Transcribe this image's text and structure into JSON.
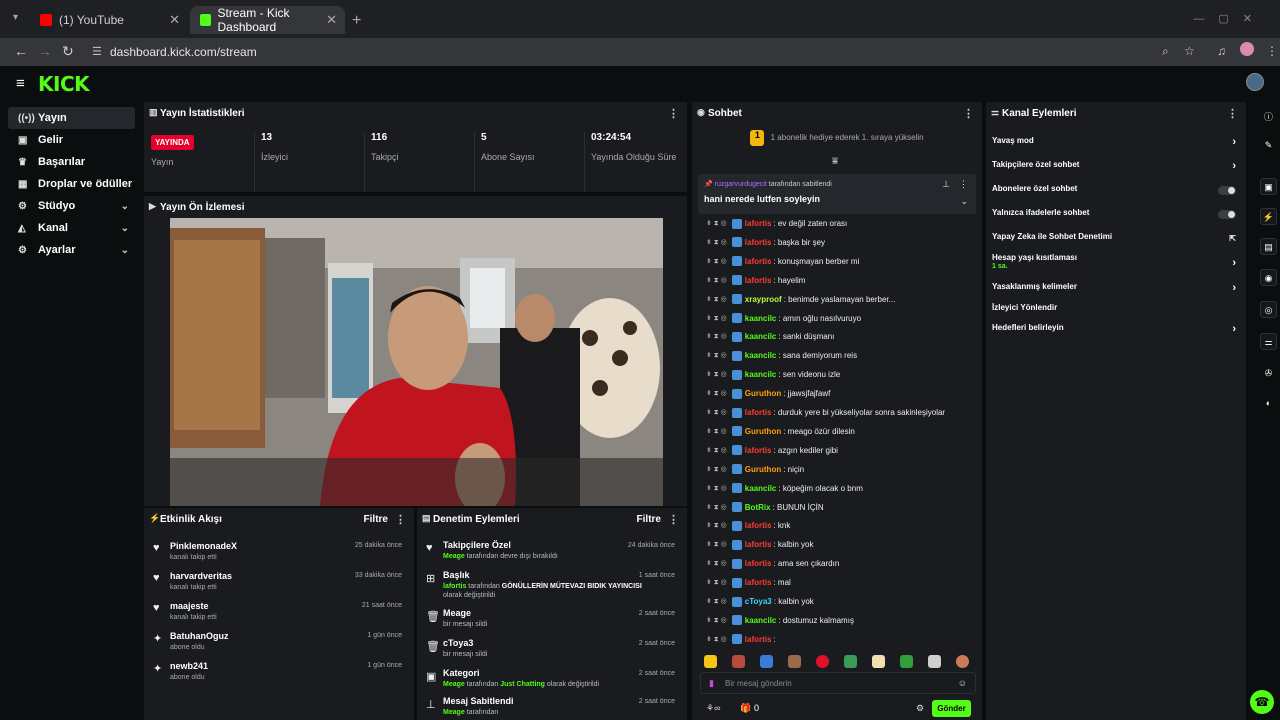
{
  "browser": {
    "tabs": [
      {
        "title": "(1) YouTube",
        "favicon_color": "#ff0000"
      },
      {
        "title": "Stream - Kick Dashboard",
        "favicon_color": "#53fc18"
      }
    ],
    "url": "dashboard.kick.com/stream"
  },
  "header": {
    "logo": "KICK"
  },
  "nav": {
    "items": [
      {
        "label": "Yayın",
        "icon": "broadcast-icon"
      },
      {
        "label": "Gelir",
        "icon": "wallet-icon"
      },
      {
        "label": "Başarılar",
        "icon": "trophy-icon"
      },
      {
        "label": "Droplar ve ödüller",
        "icon": "gift-icon"
      },
      {
        "label": "Stüdyo",
        "icon": "studio-icon"
      },
      {
        "label": "Kanal",
        "icon": "channel-icon"
      },
      {
        "label": "Ayarlar",
        "icon": "gear-icon"
      }
    ]
  },
  "stats": {
    "title": "Yayın İstatistikleri",
    "live_badge": "YAYINDA",
    "live_label": "Yayın",
    "viewers": {
      "value": "13",
      "label": "İzleyici"
    },
    "followers": {
      "value": "116",
      "label": "Takipçi"
    },
    "subs": {
      "value": "5",
      "label": "Abone Sayısı"
    },
    "uptime": {
      "value": "03:24:54",
      "label": "Yayında Olduğu Süre"
    }
  },
  "preview": {
    "title": "Yayın Ön İzlemesi"
  },
  "activity": {
    "title": "Etkinlik Akışı",
    "filter": "Filtre",
    "items": [
      {
        "name": "PinklemonadeX",
        "sub": "kanalı takip etti",
        "time": "25 dakika önce"
      },
      {
        "name": "harvardveritas",
        "sub": "kanalı takip etti",
        "time": "33 dakika önce"
      },
      {
        "name": "maajeste",
        "sub": "kanalı takip etti",
        "time": "21 saat önce"
      },
      {
        "name": "BatuhanOguz",
        "sub": "abone oldu",
        "time": "1 gün önce"
      },
      {
        "name": "newb241",
        "sub": "abone oldu",
        "time": "1 gün önce"
      }
    ]
  },
  "moderation": {
    "title": "Denetim Eylemleri",
    "filter": "Filtre",
    "items": [
      {
        "name": "Takipçilere Özel",
        "user": "Meage",
        "text": " tarafından devre dışı bırakıldı",
        "time": "24 dakika önce"
      },
      {
        "name": "Başlık",
        "user": "lafortis",
        "text": " tarafından ",
        "highlight": "GÖNÜLLERİN MÜTEVAZI BIDIK YAYINCISI",
        "tail": " olarak değiştirildi",
        "time": "1 saat önce"
      },
      {
        "name": "Meage",
        "text": "bir mesajı sildi",
        "time": "2 saat önce"
      },
      {
        "name": "cToya3",
        "text": "bir mesajı sildi",
        "time": "2 saat önce"
      },
      {
        "name": "Kategori",
        "user": "Meage",
        "text": " tarafından ",
        "green2": "Just Chatting",
        "tail": " olarak değiştirildi",
        "time": "2 saat önce"
      },
      {
        "name": "Mesaj Sabitlendi",
        "user": "Meage",
        "text": " tarafından",
        "time": "2 saat önce"
      }
    ]
  },
  "chat": {
    "title": "Sohbet",
    "promo_number": "1",
    "promo": "1 abonelik hediye ederek 1. sıraya yükselin",
    "pinned_user": "ruzgarvurdugecit",
    "pinned_by_text": " tarafından sabitlendi",
    "pinned_message": "hani nerede lutfen soyleyin",
    "messages": [
      {
        "user": "lafortis",
        "color": "#ff3b30",
        "text": "ev değil zaten orası"
      },
      {
        "user": "lafortis",
        "color": "#ff3b30",
        "text": "başka bir şey"
      },
      {
        "user": "lafortis",
        "color": "#ff3b30",
        "text": "konuşmayan berber mi"
      },
      {
        "user": "lafortis",
        "color": "#ff3b30",
        "text": "hayelim"
      },
      {
        "user": "xrayproof",
        "color": "#b9ff3b",
        "text": "benimde yaslamayan berber..."
      },
      {
        "user": "kaancilc",
        "color": "#53fc18",
        "text": "amın oğlu nasılvuruyo"
      },
      {
        "user": "kaancilc",
        "color": "#53fc18",
        "text": "sanki düşmanı"
      },
      {
        "user": "kaancilc",
        "color": "#53fc18",
        "text": "sana demiyorum reis"
      },
      {
        "user": "kaancilc",
        "color": "#53fc18",
        "text": "sen videonu izle"
      },
      {
        "user": "Guruthon",
        "color": "#ff9f0a",
        "text": "jjawsjfajfawf"
      },
      {
        "user": "lafortis",
        "color": "#ff3b30",
        "text": "durduk yere bi yükseliyolar sonra sakinleşiyolar"
      },
      {
        "user": "Guruthon",
        "color": "#ff9f0a",
        "text": "meago özür dilesin"
      },
      {
        "user": "lafortis",
        "color": "#ff3b30",
        "text": "azgın kediler gibi"
      },
      {
        "user": "Guruthon",
        "color": "#ff9f0a",
        "text": "niçin"
      },
      {
        "user": "kaancilc",
        "color": "#53fc18",
        "text": "köpeğim olacak o bnm"
      },
      {
        "user": "BotRix",
        "color": "#53fc18",
        "text": "BUNUN İÇİN"
      },
      {
        "user": "lafortis",
        "color": "#ff3b30",
        "text": "knk"
      },
      {
        "user": "lafortis",
        "color": "#ff3b30",
        "text": "kalbin yok"
      },
      {
        "user": "lafortis",
        "color": "#ff3b30",
        "text": "ama sen çıkardın"
      },
      {
        "user": "lafortis",
        "color": "#ff3b30",
        "text": "mal"
      },
      {
        "user": "cToya3",
        "color": "#3fd2ff",
        "text": "kalbin yok"
      },
      {
        "user": "kaancilc",
        "color": "#53fc18",
        "text": "dostumuz kalmamış"
      },
      {
        "user": "lafortis",
        "color": "#ff3b30",
        "text": ""
      }
    ],
    "input_placeholder": "Bir mesaj gönderin",
    "footer_count": "0",
    "send_label": "Gönder"
  },
  "channel_actions": {
    "title": "Kanal Eylemleri",
    "items": [
      {
        "label": "Yavaş mod",
        "kind": "arrow"
      },
      {
        "label": "Takipçilere özel sohbet",
        "kind": "arrow"
      },
      {
        "label": "Abonelere özel sohbet",
        "kind": "toggle"
      },
      {
        "label": "Yalnızca ifadelerle sohbet",
        "kind": "toggle"
      },
      {
        "label": "Yapay Zeka ile Sohbet Denetimi",
        "kind": "icon"
      },
      {
        "label": "Hesap yaşı kısıtlaması",
        "sub": "1 sa.",
        "kind": "arrow"
      },
      {
        "label": "Yasaklanmış kelimeler",
        "kind": "arrow"
      },
      {
        "label": "İzleyici Yönlendir",
        "kind": "none"
      },
      {
        "label": "Hedefleri belirleyin",
        "kind": "arrow"
      }
    ]
  }
}
